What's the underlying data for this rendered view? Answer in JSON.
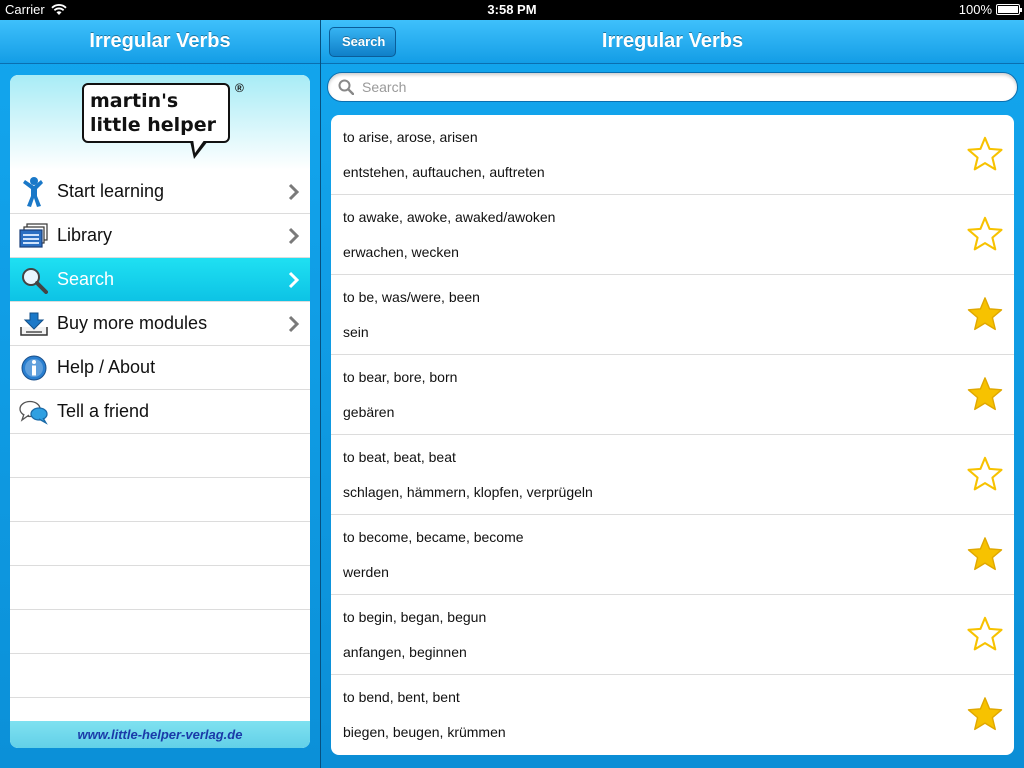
{
  "status": {
    "carrier": "Carrier",
    "time": "3:58 PM",
    "battery": "100%"
  },
  "left": {
    "title": "Irregular Verbs",
    "logo": {
      "line1": "martin's",
      "line2": "little helper",
      "reg": "®"
    },
    "menu": [
      {
        "label": "Start learning",
        "icon": "person-icon"
      },
      {
        "label": "Library",
        "icon": "library-icon"
      },
      {
        "label": "Search",
        "icon": "magnifier-icon",
        "selected": true
      },
      {
        "label": "Buy more modules",
        "icon": "download-icon"
      },
      {
        "label": "Help / About",
        "icon": "info-icon"
      },
      {
        "label": "Tell a friend",
        "icon": "chat-bubble-icon"
      }
    ],
    "footer": "www.little-helper-verlag.de"
  },
  "right": {
    "back": "Search",
    "title": "Irregular Verbs",
    "search_placeholder": "Search",
    "verbs": [
      {
        "en": "to arise, arose, arisen",
        "de": "entstehen, auftauchen, auftreten",
        "favorite": false
      },
      {
        "en": "to awake, awoke, awaked/awoken",
        "de": "erwachen, wecken",
        "favorite": false
      },
      {
        "en": "to be, was/were, been",
        "de": "sein",
        "favorite": true
      },
      {
        "en": "to bear, bore, born",
        "de": "gebären",
        "favorite": true
      },
      {
        "en": "to beat, beat, beat",
        "de": "schlagen, hämmern, klopfen, verprügeln",
        "favorite": false
      },
      {
        "en": "to become, became, become",
        "de": "werden",
        "favorite": true
      },
      {
        "en": "to begin, began, begun",
        "de": "anfangen, beginnen",
        "favorite": false
      },
      {
        "en": "to bend, bent, bent",
        "de": "biegen, beugen, krümmen",
        "favorite": true
      }
    ]
  },
  "colors": {
    "nav_blue": "#139de6",
    "selected_cyan": "#0dc3e5",
    "star_gold": "#f7c200",
    "footer_link": "#1a3aa8"
  }
}
